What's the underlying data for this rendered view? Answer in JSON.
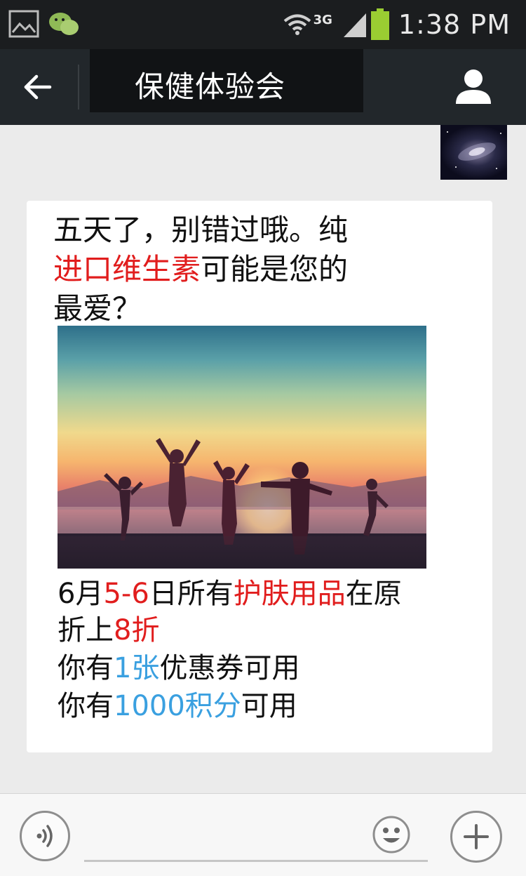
{
  "status_bar": {
    "network": "3G",
    "time": "1:38 PM"
  },
  "nav": {
    "title": "保健体验会"
  },
  "message": {
    "line1": "五天了，别错过哦。纯",
    "line2_red": "进口维生素",
    "line2_rest": "可能是您的",
    "line3": "最爱？",
    "offer1_a": "6月",
    "offer1_b": "5-6",
    "offer1_c": "日所有",
    "offer1_d": "护肤用品",
    "offer1_e": "在原",
    "offer2_a": "折上",
    "offer2_b": "8折",
    "offer3_a": "你有",
    "offer3_b": "1张",
    "offer3_c": "优惠券可用",
    "offer4_a": "你有",
    "offer4_b": "1000积分",
    "offer4_c": "可用"
  },
  "colors": {
    "highlight_red": "#e11d1d",
    "highlight_blue": "#3aa0e0",
    "nav_bg": "#22272b"
  },
  "icons": {
    "back": "back-arrow-icon",
    "profile": "profile-icon",
    "voice": "voice-icon",
    "emoji": "emoji-icon",
    "plus": "plus-icon",
    "gallery": "gallery-icon",
    "wechat": "wechat-icon",
    "wifi": "wifi-icon",
    "signal": "signal-icon",
    "battery": "battery-icon"
  }
}
